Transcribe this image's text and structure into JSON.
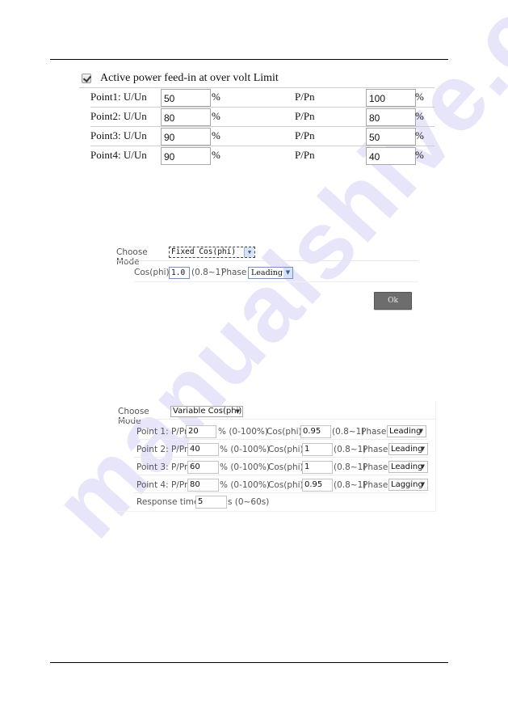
{
  "watermark": "manualshive.com",
  "feed_in": {
    "checkbox_label": "Active power feed-in at over volt Limit",
    "checked": true,
    "rows": [
      {
        "label": "Point1: U/Un",
        "u_value": "50",
        "u_unit": "%",
        "p_label": "P/Pn",
        "p_value": "100",
        "p_unit": "%"
      },
      {
        "label": "Point2: U/Un",
        "u_value": "80",
        "u_unit": "%",
        "p_label": "P/Pn",
        "p_value": "80",
        "p_unit": "%"
      },
      {
        "label": "Point3: U/Un",
        "u_value": "90",
        "u_unit": "%",
        "p_label": "P/Pn",
        "p_value": "50",
        "p_unit": "%"
      },
      {
        "label": "Point4: U/Un",
        "u_value": "90",
        "u_unit": "%",
        "p_label": "P/Pn",
        "p_value": "40",
        "p_unit": "%"
      }
    ]
  },
  "fixed_mode": {
    "mode_label": "Choose Mode",
    "mode_value": "Fixed Cos(phi)",
    "cos_label": "Cos(phi)",
    "cos_value": "1.0",
    "cos_range": "(0.8~1)",
    "phase_label": "Phase",
    "phase_value": "Leading",
    "ok_label": "Ok"
  },
  "variable_mode": {
    "mode_label": "Choose Mode",
    "mode_value": "Variable Cos(phi)",
    "points": [
      {
        "label": "Point 1: P/Pn",
        "p_value": "20",
        "p_range": "% (0-100%)",
        "cos_label": "Cos(phi)",
        "cos_value": "0.95",
        "cos_range": "(0.8~1)",
        "phase_label": "Phase",
        "phase_value": "Leading"
      },
      {
        "label": "Point 2: P/Pn",
        "p_value": "40",
        "p_range": "% (0-100%)",
        "cos_label": "Cos(phi)",
        "cos_value": "1",
        "cos_range": "(0.8~1)",
        "phase_label": "Phase",
        "phase_value": "Leading"
      },
      {
        "label": "Point 3: P/Pn",
        "p_value": "60",
        "p_range": "% (0-100%)",
        "cos_label": "Cos(phi)",
        "cos_value": "1",
        "cos_range": "(0.8~1)",
        "phase_label": "Phase",
        "phase_value": "Leading"
      },
      {
        "label": "Point 4: P/Pn",
        "p_value": "80",
        "p_range": "% (0-100%)",
        "cos_label": "Cos(phi)",
        "cos_value": "0.95",
        "cos_range": "(0.8~1)",
        "phase_label": "Phase",
        "phase_value": "Lagging"
      }
    ],
    "response_label": "Response time",
    "response_value": "5",
    "response_range": "s (0~60s)"
  }
}
